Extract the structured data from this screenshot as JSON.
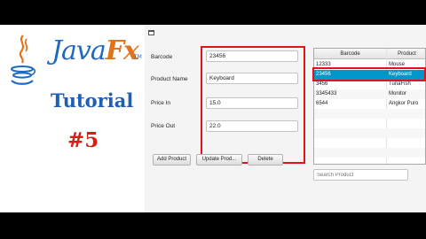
{
  "branding": {
    "logo_icon": "java-cup-icon",
    "java_text": "Java",
    "fx_text": "Fx",
    "trademark": "TM",
    "tutorial_text": "Tutorial",
    "episode": "#5"
  },
  "window": {
    "icon": "window-icon"
  },
  "form": {
    "barcode_label": "Barcode",
    "barcode_value": "23456",
    "product_name_label": "Product Name",
    "product_name_value": "Keyboard",
    "price_in_label": "Price In",
    "price_in_value": "15.0",
    "price_out_label": "Price Out",
    "price_out_value": "22.0"
  },
  "buttons": {
    "add": "Add Product",
    "update": "Update Prod...",
    "delete": "Delete"
  },
  "table": {
    "columns": [
      "Barcode",
      "Product"
    ],
    "rows": [
      [
        "12333",
        "Mouse"
      ],
      [
        "23456",
        "Keyboard"
      ],
      [
        "3456",
        "TunaFish"
      ],
      [
        "3345433",
        "Monitor"
      ],
      [
        "6544",
        "Angkor Puro"
      ]
    ],
    "selected_index": 1
  },
  "search": {
    "placeholder": "Search Product"
  },
  "colors": {
    "highlight": "#e3131b",
    "selection": "#0096c9",
    "java_blue": "#1f69c0",
    "fx_orange": "#e2731d",
    "episode_red": "#d91e18"
  }
}
